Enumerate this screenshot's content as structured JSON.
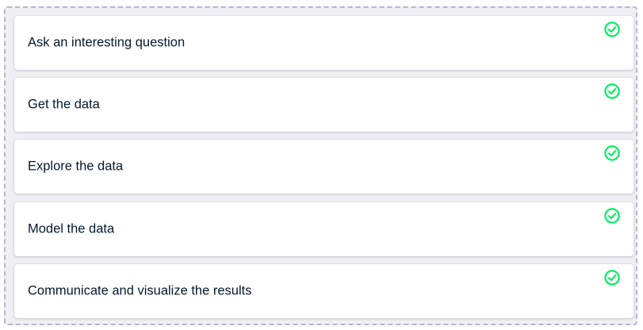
{
  "colors": {
    "check": "#03ef62",
    "text": "#05192d",
    "zone_background": "#efeef3",
    "zone_border": "#b9b4c9"
  },
  "items": [
    {
      "label": "Ask an interesting question",
      "status_icon": "check-circle-icon"
    },
    {
      "label": "Get the data",
      "status_icon": "check-circle-icon"
    },
    {
      "label": "Explore the data",
      "status_icon": "check-circle-icon"
    },
    {
      "label": "Model the data",
      "status_icon": "check-circle-icon"
    },
    {
      "label": "Communicate and visualize the results",
      "status_icon": "check-circle-icon"
    }
  ]
}
